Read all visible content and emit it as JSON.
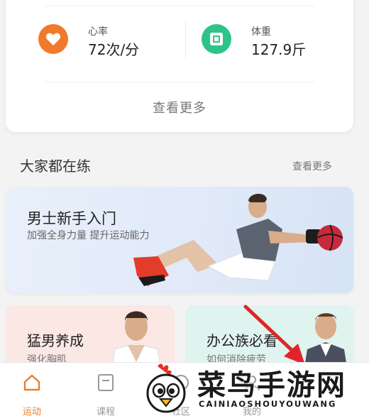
{
  "stats": {
    "heart_rate": {
      "label": "心率",
      "value": "72次/分",
      "icon": "heart-icon",
      "color": "#f07a2c"
    },
    "weight": {
      "label": "体重",
      "value": "127.9斤",
      "icon": "scale-icon",
      "color": "#2ec38b"
    },
    "see_more": "查看更多"
  },
  "section": {
    "title": "大家都在练",
    "more": "查看更多"
  },
  "banner": {
    "title": "男士新手入门",
    "subtitle": "加强全身力量 提升运动能力"
  },
  "cards": [
    {
      "title": "猛男养成",
      "subtitle": "强化胸肌"
    },
    {
      "title": "办公族必看",
      "subtitle": "如何消除疲劳"
    }
  ],
  "tabs": [
    {
      "label": "运动",
      "icon": "home-icon",
      "active": true
    },
    {
      "label": "课程",
      "icon": "course-icon",
      "active": false
    },
    {
      "label": "社区",
      "icon": "community-icon",
      "active": false
    },
    {
      "label": "我的",
      "icon": "profile-icon",
      "active": false
    }
  ],
  "watermark": {
    "title": "菜鸟手游网",
    "subtitle": "CAINIAOSHOUYOUWANG"
  },
  "colors": {
    "accent": "#f07a2c",
    "arrow": "#e0252a"
  }
}
